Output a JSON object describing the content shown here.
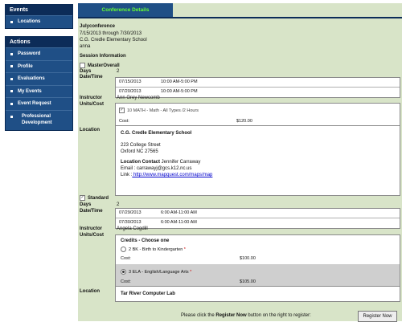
{
  "sidebar": {
    "events_header": "Events",
    "events_items": [
      {
        "label": "Locations"
      }
    ],
    "actions_header": "Actions",
    "actions_items": [
      {
        "label": "Password"
      },
      {
        "label": "Profile"
      },
      {
        "label": "Evaluations"
      },
      {
        "label": "My Events"
      },
      {
        "label": "Event Request"
      },
      {
        "label": "Professional Development"
      }
    ]
  },
  "tab": {
    "label": "Conference Details"
  },
  "conference": {
    "title": "Julyconference",
    "dates": "7/15/2013 through 7/30/2013",
    "school": "C.G. Credle Elementary School",
    "user": "anna",
    "session_header": "Session Information"
  },
  "labels": {
    "days": "Days",
    "datetime": "Date/Time",
    "instructor": "Instructor",
    "units_cost": "Units/Cost",
    "location": "Location",
    "cost": "Cost:"
  },
  "sessions": [
    {
      "name": "MasterOverall",
      "checked": false,
      "days": "2",
      "dates": [
        {
          "date": "07/15/2013",
          "time": "10:00 AM-5:00 PM"
        },
        {
          "date": "07/20/2013",
          "time": "10:00 AM-5:00 PM"
        }
      ],
      "instructor": "Ann Grey Newcomb",
      "unit": "10 MATH - Math - All Types /2 Hours",
      "cost": "$120.00",
      "location": {
        "name": "C.G. Credle Elementary School",
        "street": "223 College Street",
        "city": "Oxford NC 27565",
        "contact_label": "Location Contact",
        "contact_name": "Jennifer Carraway",
        "email_label": "Email :",
        "email": "carrawayj@gcs.k12.nc.us",
        "link_label": "Link :",
        "link": " http://www.mapquest.com/maps/map"
      }
    },
    {
      "name": "Standard",
      "checked": true,
      "days": "2",
      "dates": [
        {
          "date": "07/29/2013",
          "time": "6:00 AM-11:00 AM"
        },
        {
          "date": "07/30/2013",
          "time": "6:00 AM-11:00 AM"
        }
      ],
      "instructor": "Angela Cogdill",
      "credits_header": "Credits - Choose one",
      "credit_options": [
        {
          "label": "2 BK - Birth to Kindergarten",
          "cost": "$100.00",
          "selected": false
        },
        {
          "label": "3 ELA - English/Language Arts",
          "cost": "$105.00",
          "selected": true
        }
      ],
      "location_name": "Tar River Computer Lab"
    }
  ],
  "footer": {
    "prompt_pre": "Please click the ",
    "prompt_bold": "Register Now",
    "prompt_post": " button on the right to register:",
    "button_label": "Register Now"
  }
}
